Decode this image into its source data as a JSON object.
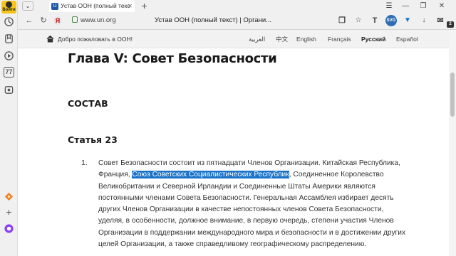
{
  "sidebar": {
    "login_label": "Войти",
    "icons": [
      "history-icon",
      "bookmark-icon",
      "play-icon",
      "seventy-seven-icon",
      "collections-icon",
      "games-icon",
      "add-icon",
      "alice-icon"
    ],
    "seventy_seven": "77"
  },
  "tabs": {
    "title": "Устав ООН (полный текс",
    "count": "2",
    "new_tab": "+"
  },
  "window": {
    "minimize": "—",
    "restore": "❐",
    "close": "✕"
  },
  "address": {
    "url": "www.un.org",
    "page_title": "Устав ООН (полный текст) | Органи..."
  },
  "toolbar_labels": {
    "translate": "T",
    "svg": "SVG",
    "counter": "2"
  },
  "site_header": {
    "welcome": "Добро пожаловать в ООН!",
    "languages": [
      {
        "label": "العربية",
        "active": false
      },
      {
        "label": "中文",
        "active": false
      },
      {
        "label": "English",
        "active": false
      },
      {
        "label": "Français",
        "active": false
      },
      {
        "label": "Русский",
        "active": true
      },
      {
        "label": "Español",
        "active": false
      }
    ]
  },
  "content": {
    "chapter_title": "Глава V: Совет Безопасности",
    "section_title": "СОСТАВ",
    "article_title": "Статья 23",
    "item_number": "1.",
    "paragraph_before": "Совет Безопасности состоит из пятнадцати Членов Организации. Китайская Республика, Франция, ",
    "paragraph_highlight": "Союз Советских Социалистических Республик",
    "paragraph_after": ", Соединенное Королевство Великобритании и Северной Ирландии и Соединенные Штаты Америки являются постоянными членами Совета Безопасности. Генеральная Ассамблея избирает десять других Членов Организации в качестве непостоянных членов Совета Безопасности, уделяя, в особенности, должное внимание, в первую очередь, степени участия Членов Организации в поддержании международного мира и безопасности и в достижении других целей Организации, а также справедливому географическому распределению."
  },
  "colors": {
    "highlight": "#1a73c9",
    "login_bg": "#f5c518"
  }
}
